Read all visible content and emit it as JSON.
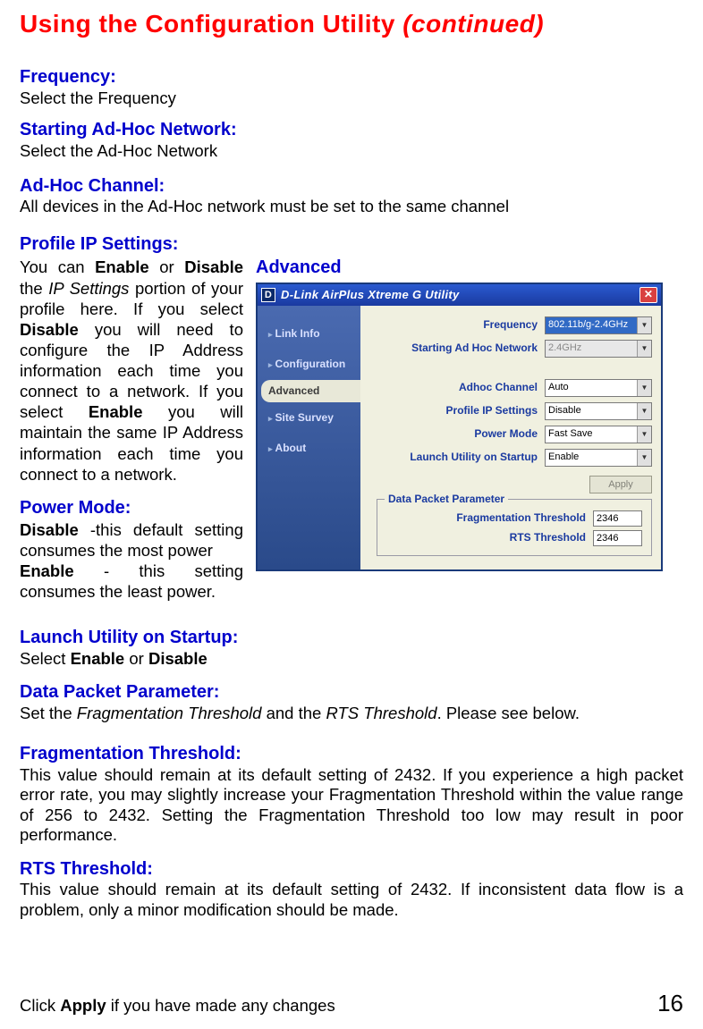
{
  "page": {
    "title_main": "Using the Configuration Utility",
    "title_cont": "(continued)",
    "number": "16",
    "footer_prefix": "Click ",
    "footer_bold": "Apply",
    "footer_suffix": " if you have made any changes"
  },
  "sections": {
    "frequency": {
      "h": "Frequency:",
      "body": "Select the Frequency"
    },
    "starting": {
      "h": "Starting Ad-Hoc Network:",
      "body": "Select the Ad-Hoc Network"
    },
    "adhoc_channel": {
      "h": "Ad-Hoc Channel:",
      "body": "All devices in the Ad-Hoc network must be set to the same channel"
    },
    "profile_ip": {
      "h": "Profile IP Settings:",
      "body_pre": "You can ",
      "b1": "Enable",
      "mid1": " or ",
      "b2": "Disable",
      "mid2": " the ",
      "i1": "IP Settings",
      "mid3": " portion of your profile here. If you select ",
      "b3": "Disable",
      "mid4": " you will need to configure the IP Address information each time you connect to a network. If you select ",
      "b4": "Enable",
      "mid5": " you will maintain the same IP Address information each time you connect to a network."
    },
    "power_mode": {
      "h": "Power Mode:",
      "b1": "Disable",
      "l1": " -this default setting consumes the most power",
      "b2": "Enable",
      "l2": " - this setting consumes the least power."
    },
    "launch": {
      "h": "Launch Utility on Startup:",
      "pre": "Select ",
      "b1": "Enable",
      "mid": " or ",
      "b2": "Disable"
    },
    "data_packet": {
      "h": "Data Packet Parameter:",
      "pre": "Set the ",
      "i1": "Fragmentation Threshold",
      "mid": " and the ",
      "i2": "RTS Threshold",
      "suf": ". Please see below."
    },
    "frag": {
      "h": "Fragmentation Threshold:",
      "body": "This value should remain at its default setting of 2432. If you experience a high packet error rate, you may slightly increase your Fragmentation Threshold within the value range of 256 to 2432. Setting the Fragmentation Threshold too low may result in poor performance."
    },
    "rts": {
      "h": "RTS Threshold:",
      "body": "This value should remain at its default setting of 2432. If inconsistent data flow is a problem, only a minor modification should be made."
    },
    "advanced_heading": "Advanced"
  },
  "app": {
    "title": "D-Link AirPlus Xtreme G Utility",
    "icon_letter": "D",
    "close": "✕",
    "nav": {
      "link_info": "Link Info",
      "configuration": "Configuration",
      "advanced": "Advanced",
      "site_survey": "Site Survey",
      "about": "About"
    },
    "form": {
      "frequency_label": "Frequency",
      "frequency_value": "802.11b/g-2.4GHz",
      "starting_label": "Starting Ad Hoc Network",
      "starting_value": "2.4GHz",
      "adhoc_label": "Adhoc Channel",
      "adhoc_value": "Auto",
      "profile_label": "Profile IP Settings",
      "profile_value": "Disable",
      "power_label": "Power Mode",
      "power_value": "Fast Save",
      "launch_label": "Launch Utility on Startup",
      "launch_value": "Enable",
      "apply": "Apply",
      "fieldset_legend": "Data Packet Parameter",
      "frag_label": "Fragmentation Threshold",
      "frag_value": "2346",
      "rts_label": "RTS Threshold",
      "rts_value": "2346"
    }
  }
}
